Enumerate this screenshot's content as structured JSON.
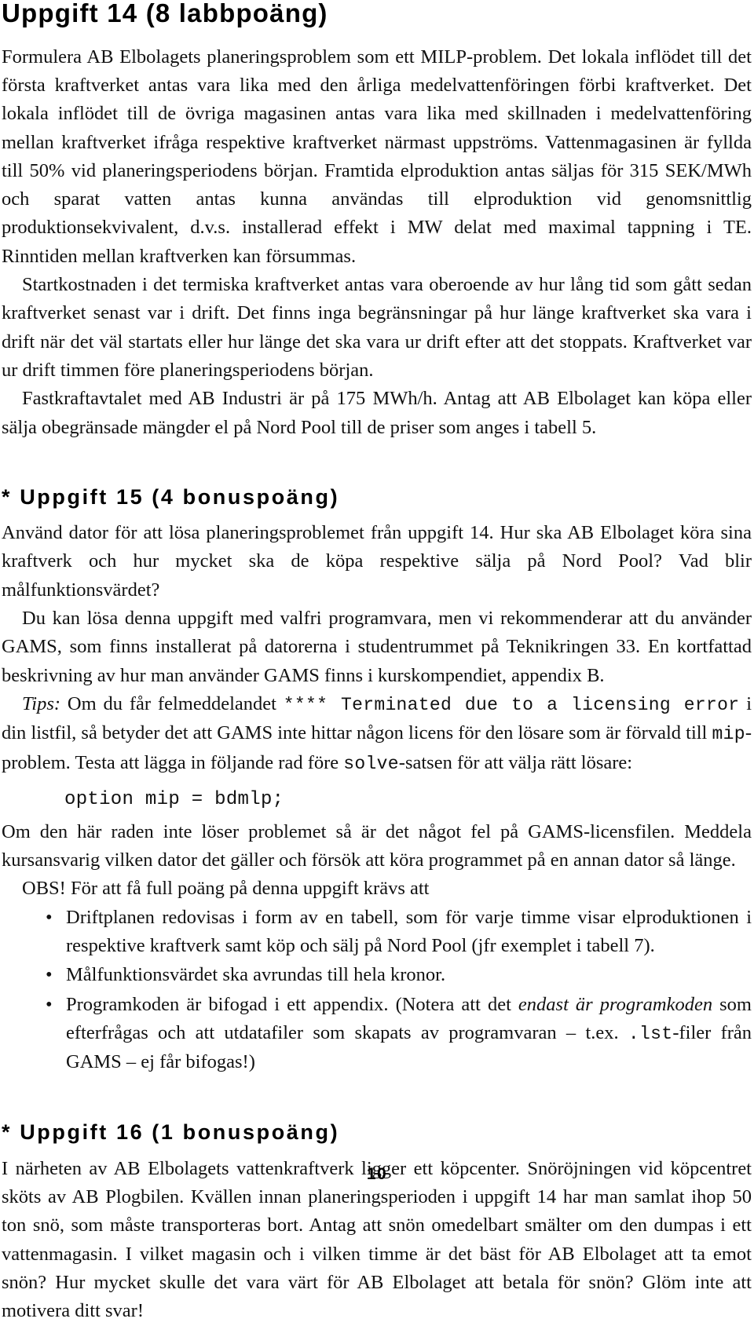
{
  "page": {
    "number": "10"
  },
  "sections": [
    {
      "heading": "Uppgift 14 (8 labbpoäng)",
      "paragraphs": [
        "Formulera AB Elbolagets planeringsproblem som ett MILP-problem. Det lokala inflödet till det första kraftverket antas vara lika med den årliga medelvattenföringen förbi kraftverket. Det lokala inflödet till de övriga magasinen antas vara lika med skillnaden i medelvattenföring mellan kraftverket ifråga respektive kraftverket närmast uppströms. Vattenmagasinen är fyllda till 50% vid planeringsperiodens början. Framtida elproduktion antas säljas för 315 SEK/MWh och sparat vatten antas kunna användas till elproduktion vid genomsnittlig produktionsekvivalent, d.v.s. installerad effekt i MW delat med maximal tappning i TE. Rinntiden mellan kraftverken kan försummas.",
        "Startkostnaden i det termiska kraftverket antas vara oberoende av hur lång tid som gått sedan kraftverket senast var i drift. Det finns inga begränsningar på hur länge kraftverket ska vara i drift när det väl startats eller hur länge det ska vara ur drift efter att det stoppats. Kraftverket var ur drift timmen före planeringsperiodens början.",
        "Fastkraftavtalet med AB Industri är på 175 MWh/h. Antag att AB Elbolaget kan köpa eller sälja obegränsade mängder el på Nord Pool till de priser som anges i tabell 5."
      ]
    },
    {
      "heading": "* Uppgift 15 (4 bonuspoäng)",
      "paragraphs": [
        "Använd dator för att lösa planeringsproblemet från uppgift 14. Hur ska AB Elbolaget köra sina kraftverk och hur mycket ska de köpa respektive sälja på Nord Pool? Vad blir målfunktionsvärdet?",
        "Du kan lösa denna uppgift med valfri programvara, men vi rekommenderar att du använder GAMS, som finns installerat på datorerna i studentrummet på Teknikringen 33. En kortfattad beskrivning av hur man använder GAMS finns i kurskompendiet, appendix B."
      ],
      "tips": {
        "label": "Tips:",
        "part1": " Om du får felmeddelandet ",
        "code1": "**** Terminated due to a licensing error",
        "part2": " i din listfil, så betyder det att GAMS inte hittar någon licens för den lösare som är förvald till ",
        "code2": "mip",
        "part3": "-problem. Testa att lägga in följande rad före ",
        "code3": "solve",
        "part4": "-satsen för att välja rätt lösare:"
      },
      "code_block": "option mip = bdmlp;",
      "after_code": [
        "Om den här raden inte löser problemet så är det något fel på GAMS-licensfilen. Meddela kursansvarig vilken dator det gäller och försök att köra programmet på en annan dator så länge.",
        "OBS! För att få full poäng på denna uppgift krävs att"
      ],
      "requirements": [
        {
          "bullet": "•",
          "text": "Driftplanen redovisas i form av en tabell, som för varje timme visar elproduktionen i respektive kraftverk samt köp och sälj på Nord Pool (jfr exemplet i tabell 7)."
        },
        {
          "bullet": "•",
          "text": "Målfunktionsvärdet ska avrundas till hela kronor."
        },
        {
          "bullet": "•",
          "parts": {
            "p1": "Programkoden är bifogad i ett appendix. (Notera att det ",
            "italic": "endast är programkoden",
            "p2": " som efterfrågas och att utdatafiler som skapats av programvaran – t.ex. ",
            "code": ".lst",
            "p3": "-filer från GAMS – ej får bifogas!)"
          }
        }
      ]
    },
    {
      "heading": "* Uppgift 16 (1 bonuspoäng)",
      "paragraphs": [
        "I närheten av AB Elbolagets vattenkraftverk ligger ett köpcenter. Snöröjningen vid köpcentret sköts av AB Plogbilen. Kvällen innan planeringsperioden i uppgift 14 har man samlat ihop 50 ton snö, som måste transporteras bort. Antag att snön omedelbart smälter om den dumpas i ett vattenmagasin. I vilket magasin och i vilken timme är det bäst för AB Elbolaget att ta emot snön? Hur mycket skulle det vara värt för AB Elbolaget att betala för snön? Glöm inte att motivera ditt svar!"
      ]
    }
  ]
}
